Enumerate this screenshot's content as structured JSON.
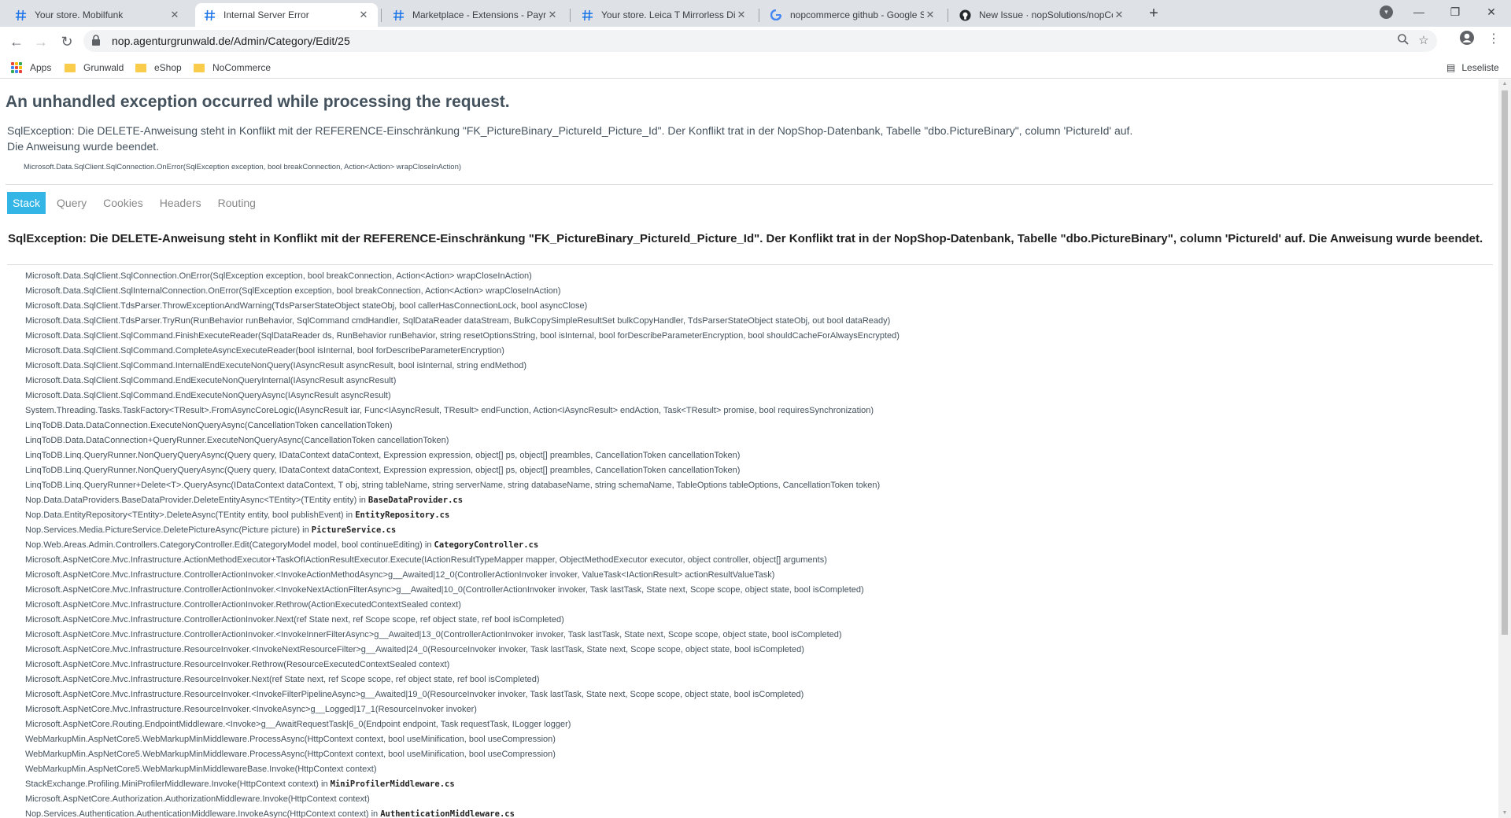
{
  "browser": {
    "tabs": [
      {
        "title": "Your store. Mobilfunk",
        "favicon": "store-icon",
        "active": false
      },
      {
        "title": "Internal Server Error",
        "favicon": "store-icon",
        "active": true
      },
      {
        "title": "Marketplace - Extensions - Paym",
        "favicon": "store-icon",
        "active": false
      },
      {
        "title": "Your store. Leica T Mirrorless Dig",
        "favicon": "store-icon",
        "active": false
      },
      {
        "title": "nopcommerce github - Google S",
        "favicon": "google-icon",
        "active": false
      },
      {
        "title": "New Issue · nopSolutions/nopCo",
        "favicon": "github-icon",
        "active": false
      }
    ],
    "url": "nop.agenturgrunwald.de/Admin/Category/Edit/25",
    "bookmarks": [
      {
        "label": "Apps",
        "type": "apps"
      },
      {
        "label": "Grunwald",
        "type": "folder"
      },
      {
        "label": "eShop",
        "type": "folder"
      },
      {
        "label": "NoCommerce",
        "type": "folder"
      }
    ],
    "reading_list": "Leseliste"
  },
  "error_page": {
    "heading": "An unhandled exception occurred while processing the request.",
    "message": "SqlException: Die DELETE-Anweisung steht in Konflikt mit der REFERENCE-Einschränkung \"FK_PictureBinary_PictureId_Picture_Id\". Der Konflikt trat in der NopShop-Datenbank, Tabelle \"dbo.PictureBinary\", column 'PictureId' auf.\nDie Anweisung wurde beendet.",
    "origin": "Microsoft.Data.SqlClient.SqlConnection.OnError(SqlException exception, bool breakConnection, Action<Action> wrapCloseInAction)",
    "tabs": [
      "Stack",
      "Query",
      "Cookies",
      "Headers",
      "Routing"
    ],
    "selected_tab": "Stack",
    "stack_title": "SqlException: Die DELETE-Anweisung steht in Konflikt mit der REFERENCE-Einschränkung \"FK_PictureBinary_PictureId_Picture_Id\". Der Konflikt trat in der NopShop-Datenbank, Tabelle \"dbo.PictureBinary\", column 'PictureId' auf. Die Anweisung wurde beendet.",
    "frames": [
      {
        "method": "Microsoft.Data.SqlClient.SqlConnection.OnError(SqlException exception, bool breakConnection, Action<Action> wrapCloseInAction)",
        "file": ""
      },
      {
        "method": "Microsoft.Data.SqlClient.SqlInternalConnection.OnError(SqlException exception, bool breakConnection, Action<Action> wrapCloseInAction)",
        "file": ""
      },
      {
        "method": "Microsoft.Data.SqlClient.TdsParser.ThrowExceptionAndWarning(TdsParserStateObject stateObj, bool callerHasConnectionLock, bool asyncClose)",
        "file": ""
      },
      {
        "method": "Microsoft.Data.SqlClient.TdsParser.TryRun(RunBehavior runBehavior, SqlCommand cmdHandler, SqlDataReader dataStream, BulkCopySimpleResultSet bulkCopyHandler, TdsParserStateObject stateObj, out bool dataReady)",
        "file": ""
      },
      {
        "method": "Microsoft.Data.SqlClient.SqlCommand.FinishExecuteReader(SqlDataReader ds, RunBehavior runBehavior, string resetOptionsString, bool isInternal, bool forDescribeParameterEncryption, bool shouldCacheForAlwaysEncrypted)",
        "file": ""
      },
      {
        "method": "Microsoft.Data.SqlClient.SqlCommand.CompleteAsyncExecuteReader(bool isInternal, bool forDescribeParameterEncryption)",
        "file": ""
      },
      {
        "method": "Microsoft.Data.SqlClient.SqlCommand.InternalEndExecuteNonQuery(IAsyncResult asyncResult, bool isInternal, string endMethod)",
        "file": ""
      },
      {
        "method": "Microsoft.Data.SqlClient.SqlCommand.EndExecuteNonQueryInternal(IAsyncResult asyncResult)",
        "file": ""
      },
      {
        "method": "Microsoft.Data.SqlClient.SqlCommand.EndExecuteNonQueryAsync(IAsyncResult asyncResult)",
        "file": ""
      },
      {
        "method": "System.Threading.Tasks.TaskFactory<TResult>.FromAsyncCoreLogic(IAsyncResult iar, Func<IAsyncResult, TResult> endFunction, Action<IAsyncResult> endAction, Task<TResult> promise, bool requiresSynchronization)",
        "file": ""
      },
      {
        "method": "LinqToDB.Data.DataConnection.ExecuteNonQueryAsync(CancellationToken cancellationToken)",
        "file": ""
      },
      {
        "method": "LinqToDB.Data.DataConnection+QueryRunner.ExecuteNonQueryAsync(CancellationToken cancellationToken)",
        "file": ""
      },
      {
        "method": "LinqToDB.Linq.QueryRunner.NonQueryQueryAsync(Query query, IDataContext dataContext, Expression expression, object[] ps, object[] preambles, CancellationToken cancellationToken)",
        "file": ""
      },
      {
        "method": "LinqToDB.Linq.QueryRunner.NonQueryQueryAsync(Query query, IDataContext dataContext, Expression expression, object[] ps, object[] preambles, CancellationToken cancellationToken)",
        "file": ""
      },
      {
        "method": "LinqToDB.Linq.QueryRunner+Delete<T>.QueryAsync(IDataContext dataContext, T obj, string tableName, string serverName, string databaseName, string schemaName, TableOptions tableOptions, CancellationToken token)",
        "file": ""
      },
      {
        "method": "Nop.Data.DataProviders.BaseDataProvider.DeleteEntityAsync<TEntity>(TEntity entity) in ",
        "file": "BaseDataProvider.cs"
      },
      {
        "method": "Nop.Data.EntityRepository<TEntity>.DeleteAsync(TEntity entity, bool publishEvent) in ",
        "file": "EntityRepository.cs"
      },
      {
        "method": "Nop.Services.Media.PictureService.DeletePictureAsync(Picture picture) in ",
        "file": "PictureService.cs"
      },
      {
        "method": "Nop.Web.Areas.Admin.Controllers.CategoryController.Edit(CategoryModel model, bool continueEditing) in ",
        "file": "CategoryController.cs"
      },
      {
        "method": "Microsoft.AspNetCore.Mvc.Infrastructure.ActionMethodExecutor+TaskOfIActionResultExecutor.Execute(IActionResultTypeMapper mapper, ObjectMethodExecutor executor, object controller, object[] arguments)",
        "file": ""
      },
      {
        "method": "Microsoft.AspNetCore.Mvc.Infrastructure.ControllerActionInvoker.<InvokeActionMethodAsync>g__Awaited|12_0(ControllerActionInvoker invoker, ValueTask<IActionResult> actionResultValueTask)",
        "file": ""
      },
      {
        "method": "Microsoft.AspNetCore.Mvc.Infrastructure.ControllerActionInvoker.<InvokeNextActionFilterAsync>g__Awaited|10_0(ControllerActionInvoker invoker, Task lastTask, State next, Scope scope, object state, bool isCompleted)",
        "file": ""
      },
      {
        "method": "Microsoft.AspNetCore.Mvc.Infrastructure.ControllerActionInvoker.Rethrow(ActionExecutedContextSealed context)",
        "file": ""
      },
      {
        "method": "Microsoft.AspNetCore.Mvc.Infrastructure.ControllerActionInvoker.Next(ref State next, ref Scope scope, ref object state, ref bool isCompleted)",
        "file": ""
      },
      {
        "method": "Microsoft.AspNetCore.Mvc.Infrastructure.ControllerActionInvoker.<InvokeInnerFilterAsync>g__Awaited|13_0(ControllerActionInvoker invoker, Task lastTask, State next, Scope scope, object state, bool isCompleted)",
        "file": ""
      },
      {
        "method": "Microsoft.AspNetCore.Mvc.Infrastructure.ResourceInvoker.<InvokeNextResourceFilter>g__Awaited|24_0(ResourceInvoker invoker, Task lastTask, State next, Scope scope, object state, bool isCompleted)",
        "file": ""
      },
      {
        "method": "Microsoft.AspNetCore.Mvc.Infrastructure.ResourceInvoker.Rethrow(ResourceExecutedContextSealed context)",
        "file": ""
      },
      {
        "method": "Microsoft.AspNetCore.Mvc.Infrastructure.ResourceInvoker.Next(ref State next, ref Scope scope, ref object state, ref bool isCompleted)",
        "file": ""
      },
      {
        "method": "Microsoft.AspNetCore.Mvc.Infrastructure.ResourceInvoker.<InvokeFilterPipelineAsync>g__Awaited|19_0(ResourceInvoker invoker, Task lastTask, State next, Scope scope, object state, bool isCompleted)",
        "file": ""
      },
      {
        "method": "Microsoft.AspNetCore.Mvc.Infrastructure.ResourceInvoker.<InvokeAsync>g__Logged|17_1(ResourceInvoker invoker)",
        "file": ""
      },
      {
        "method": "Microsoft.AspNetCore.Routing.EndpointMiddleware.<Invoke>g__AwaitRequestTask|6_0(Endpoint endpoint, Task requestTask, ILogger logger)",
        "file": ""
      },
      {
        "method": "WebMarkupMin.AspNetCore5.WebMarkupMinMiddleware.ProcessAsync(HttpContext context, bool useMinification, bool useCompression)",
        "file": ""
      },
      {
        "method": "WebMarkupMin.AspNetCore5.WebMarkupMinMiddleware.ProcessAsync(HttpContext context, bool useMinification, bool useCompression)",
        "file": ""
      },
      {
        "method": "WebMarkupMin.AspNetCore5.WebMarkupMinMiddlewareBase.Invoke(HttpContext context)",
        "file": ""
      },
      {
        "method": "StackExchange.Profiling.MiniProfilerMiddleware.Invoke(HttpContext context) in ",
        "file": "MiniProfilerMiddleware.cs"
      },
      {
        "method": "Microsoft.AspNetCore.Authorization.AuthorizationMiddleware.Invoke(HttpContext context)",
        "file": ""
      },
      {
        "method": "Nop.Services.Authentication.AuthenticationMiddleware.InvokeAsync(HttpContext context) in ",
        "file": "AuthenticationMiddleware.cs"
      }
    ]
  },
  "colors": {
    "accent": "#33b5e5",
    "text": "#44525e",
    "chrome_bg": "#dee1e6"
  }
}
